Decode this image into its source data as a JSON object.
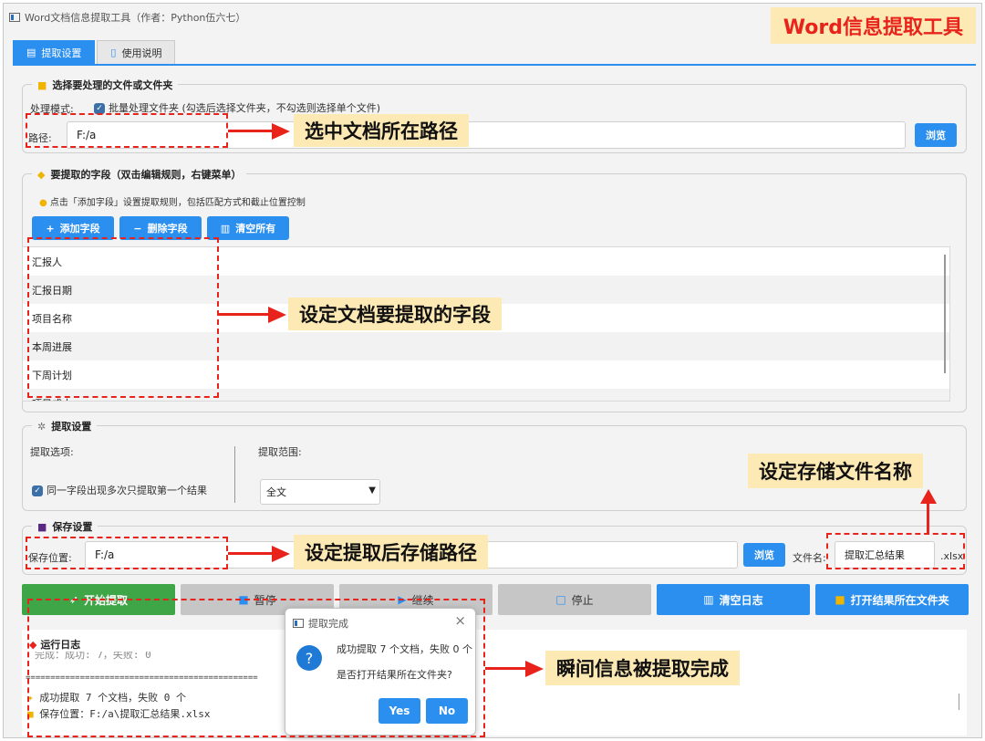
{
  "window": {
    "title": "Word文档信息提取工具（作者：Python伍六七）",
    "badge": "Word信息提取工具"
  },
  "tabs": [
    {
      "label": "提取设置",
      "icon": "document-icon",
      "active": true
    },
    {
      "label": "使用说明",
      "icon": "book-icon",
      "active": false
    }
  ],
  "select_group": {
    "title": "选择要处理的文件或文件夹",
    "mode_label": "处理模式:",
    "batch_checkbox": "批量处理文件夹 (勾选后选择文件夹，不勾选则选择单个文件)",
    "path_label": "路径:",
    "path_value": "F:/a",
    "browse": "浏览"
  },
  "fields_group": {
    "title": "要提取的字段（双击编辑规则，右键菜单）",
    "tip": "点击「添加字段」设置提取规则，包括匹配方式和截止位置控制",
    "add_button": "添加字段",
    "delete_button": "删除字段",
    "clear_button": "清空所有",
    "items": [
      "汇报人",
      "汇报日期",
      "项目名称",
      "本周进展",
      "下周计划",
      "项目成本"
    ]
  },
  "extract_group": {
    "title": "提取设置",
    "options_label": "提取选项:",
    "first_result_checkbox": "同一字段出现多次只提取第一个结果",
    "range_label": "提取范围:",
    "range_value": "全文"
  },
  "save_group": {
    "title": "保存设置",
    "location_label": "保存位置:",
    "location_value": "F:/a",
    "browse": "浏览",
    "filename_label": "文件名:",
    "filename_value": "提取汇总结果",
    "extension": ".xlsx"
  },
  "actions": {
    "start": "开始提取",
    "pause": "暂停",
    "resume": "继续",
    "stop": "停止",
    "clear_log": "清空日志",
    "open_folder": "打开结果所在文件夹"
  },
  "log": {
    "title": "运行日志",
    "partial_line": "完成：成功: 7，失败: 0",
    "separator": "===============================================",
    "success_line": "成功提取 7 个文档，失败 0 个",
    "save_line": "保存位置：F:/a\\提取汇总结果.xlsx"
  },
  "dialog": {
    "title": "提取完成",
    "message": "成功提取 7 个文档，失败 0 个",
    "question": "是否打开结果所在文件夹?",
    "yes": "Yes",
    "no": "No"
  },
  "annotations": {
    "path_callout": "选中文档所在路径",
    "fields_callout": "设定文档要提取的字段",
    "filename_callout": "设定存储文件名称",
    "save_callout": "设定提取后存储路径",
    "done_callout": "瞬间信息被提取完成"
  },
  "colors": {
    "accent": "#2b8ff0",
    "start_green": "#3fa648",
    "annotation_red": "#e8231c",
    "callout_bg": "#fde9b3"
  }
}
